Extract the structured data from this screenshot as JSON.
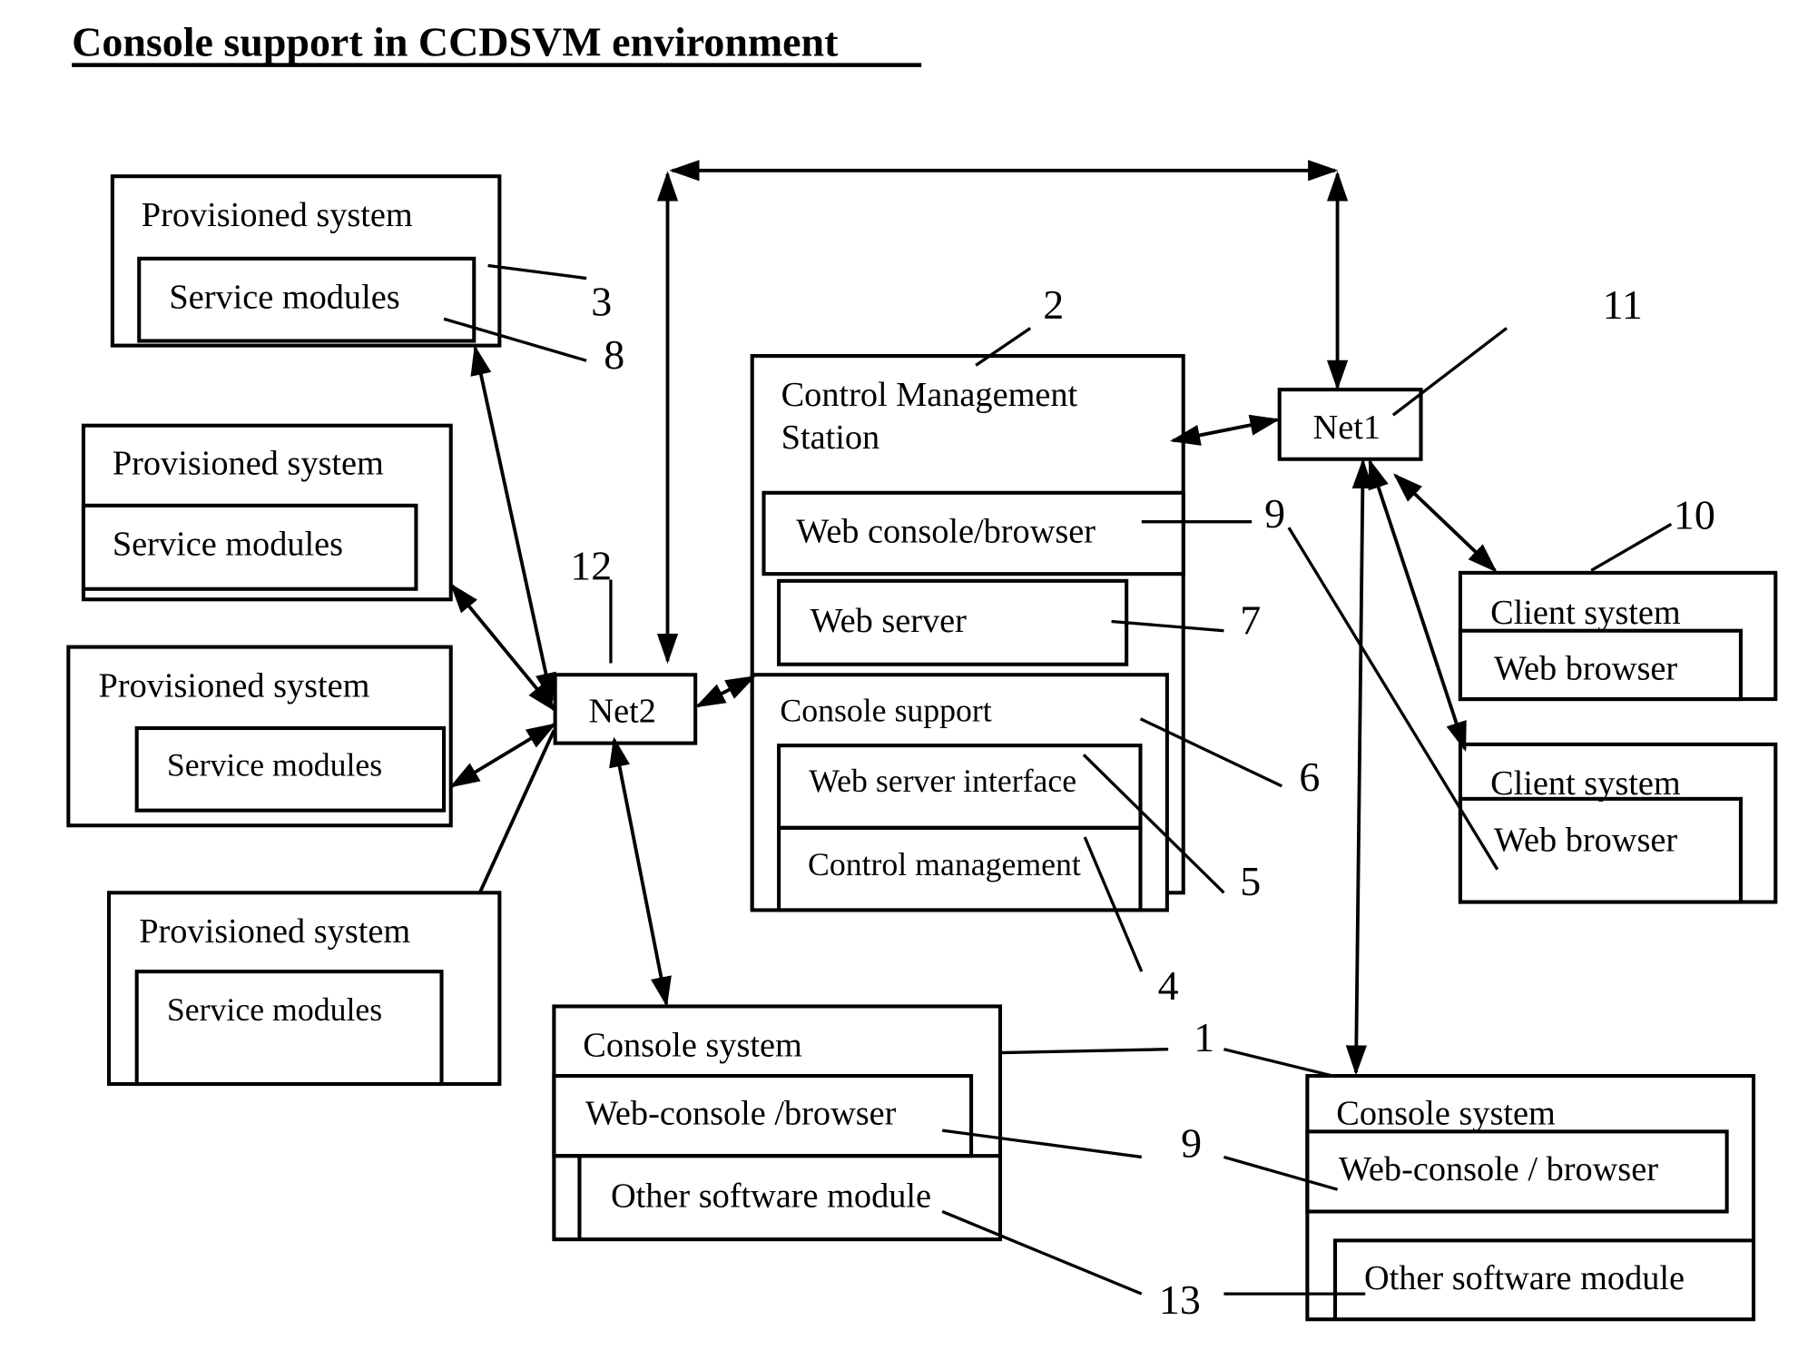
{
  "title": "Console support in CCDSVM environment",
  "provisioned_systems": [
    {
      "label": "Provisioned system",
      "module": "Service modules"
    },
    {
      "label": "Provisioned system",
      "module": "Service modules"
    },
    {
      "label": "Provisioned system",
      "module": "Service modules"
    },
    {
      "label": "Provisioned system",
      "module": "Service modules"
    }
  ],
  "networks": {
    "net1": "Net1",
    "net2": "Net2"
  },
  "control_station": {
    "title_line1": "Control Management",
    "title_line2": "Station",
    "web_console": "Web console/browser",
    "web_server": "Web server",
    "console_support": {
      "label": "Console support",
      "web_server_interface": "Web server interface",
      "control_management": "Control management"
    }
  },
  "client_systems": [
    {
      "label": "Client system",
      "browser": "Web browser"
    },
    {
      "label": "Client system",
      "browser": "Web browser"
    }
  ],
  "console_systems": [
    {
      "label": "Console system",
      "web_console": "Web-console /browser",
      "other": "Other software module"
    },
    {
      "label": "Console system",
      "web_console": "Web-console / browser",
      "other": "Other software module"
    }
  ],
  "reference_numerals": {
    "n1": "1",
    "n2": "2",
    "n3": "3",
    "n4": "4",
    "n5": "5",
    "n6": "6",
    "n7": "7",
    "n8": "8",
    "n9a": "9",
    "n9b": "9",
    "n10": "10",
    "n11": "11",
    "n12": "12",
    "n13": "13"
  }
}
